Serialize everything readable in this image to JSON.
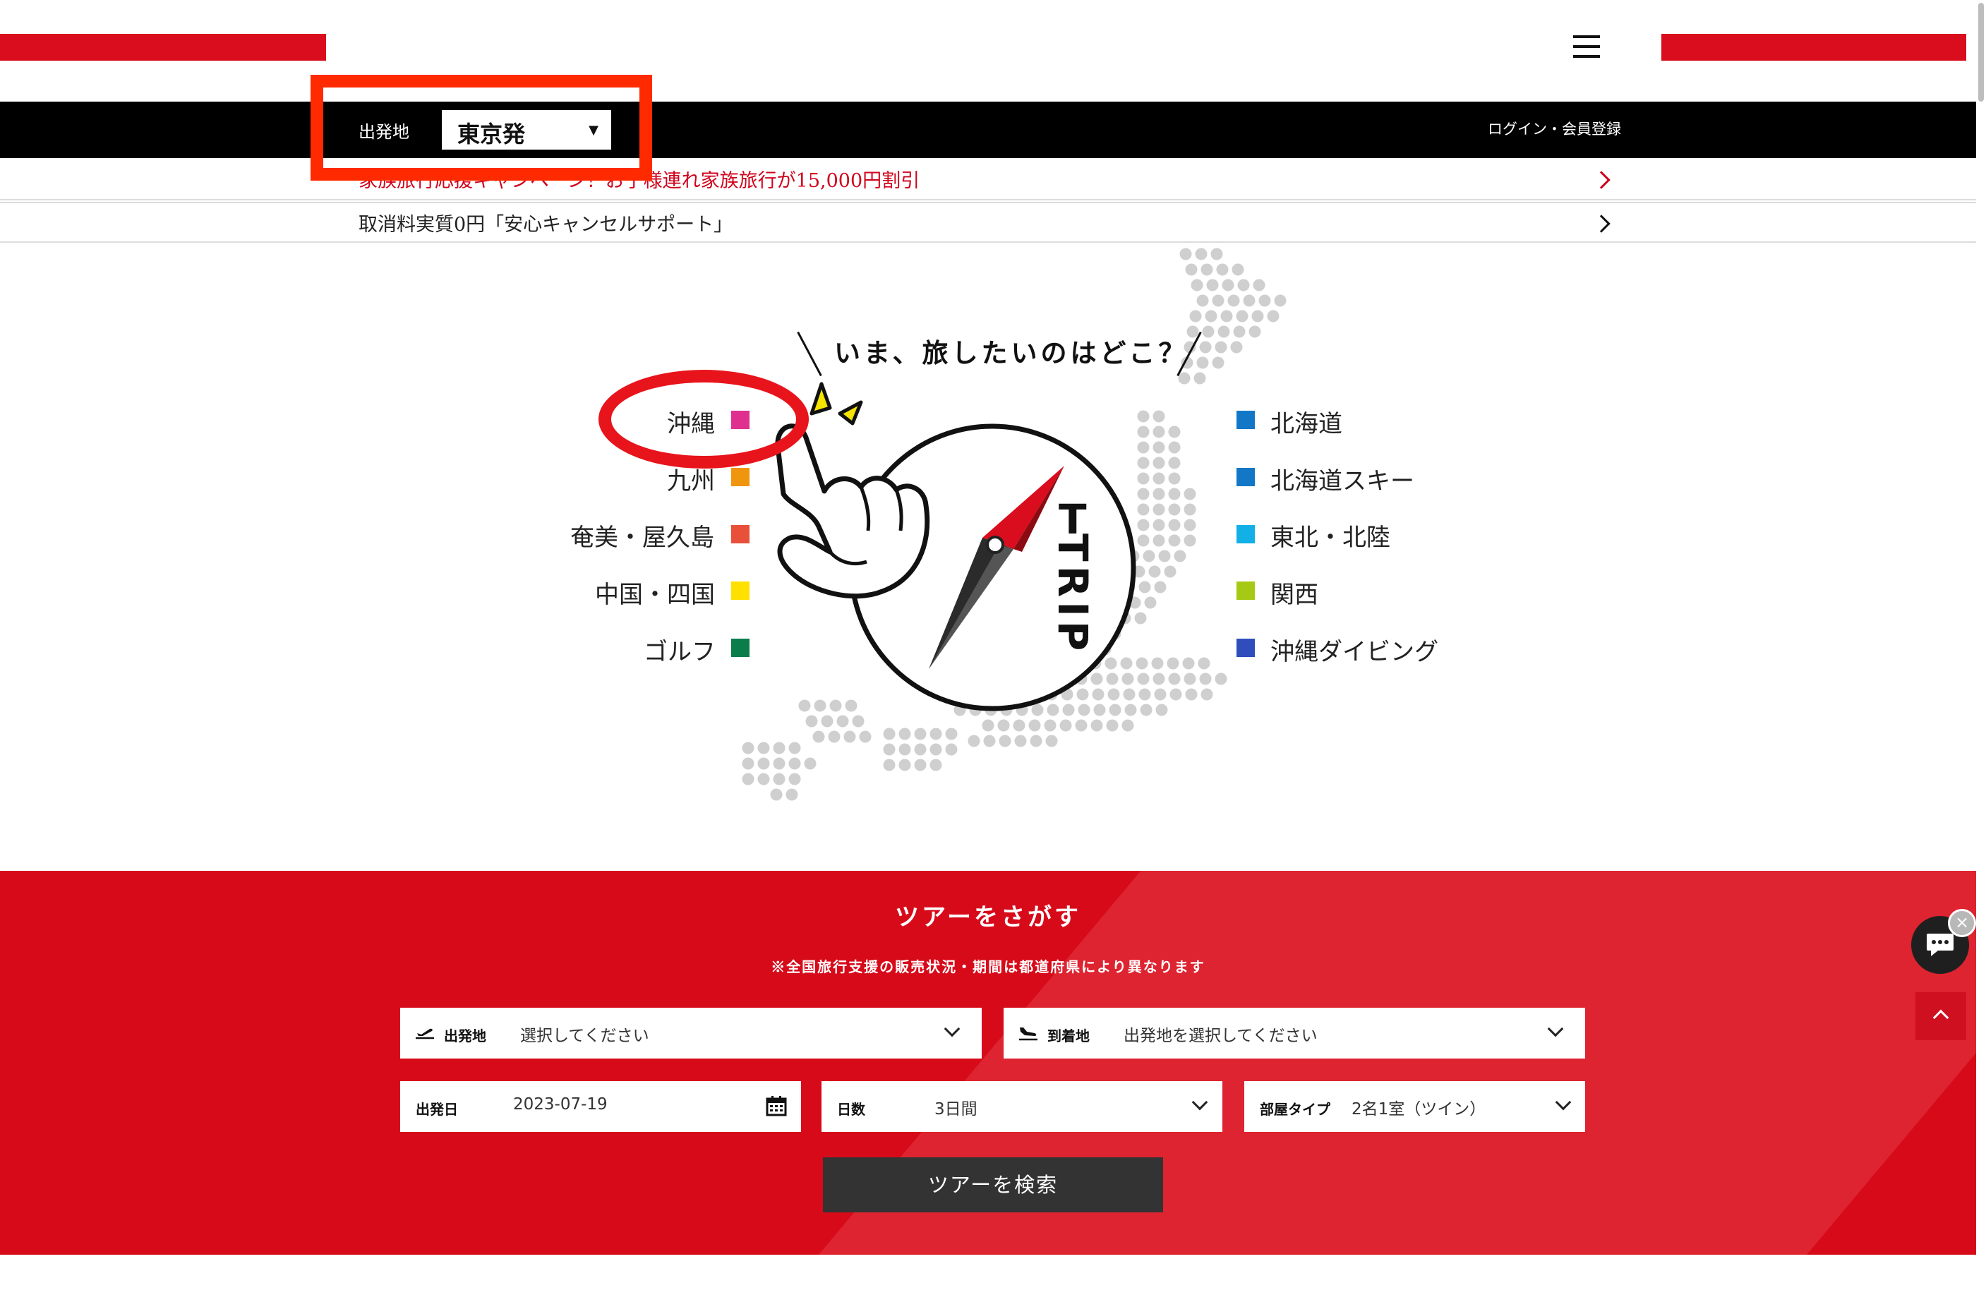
{
  "header": {
    "menu_icon": "hamburger-menu-icon",
    "departure_label": "出発地",
    "departure_value": "東京発",
    "login_link": "ログイン・会員登録"
  },
  "notices": [
    {
      "text": "家族旅行応援キャンペーン！お子様連れ家族旅行が15,000円割引",
      "color": "#d0021b"
    },
    {
      "text": "取消料実質0円「安心キャンセルサポート」",
      "color": "#222222"
    }
  ],
  "hero": {
    "headline": "いま、旅したいのはどこ？",
    "logo_letter": "J",
    "logo_text": "TRIP",
    "destinations_left": [
      {
        "label": "沖縄",
        "color": "#e0308f"
      },
      {
        "label": "九州",
        "color": "#f0950e"
      },
      {
        "label": "奄美・屋久島",
        "color": "#e8503a"
      },
      {
        "label": "中国・四国",
        "color": "#ffe000"
      },
      {
        "label": "ゴルフ",
        "color": "#0a7d4b"
      }
    ],
    "destinations_right": [
      {
        "label": "北海道",
        "color": "#1277c6"
      },
      {
        "label": "北海道スキー",
        "color": "#1277c6"
      },
      {
        "label": "東北・北陸",
        "color": "#12b0e6"
      },
      {
        "label": "関西",
        "color": "#a5c914"
      },
      {
        "label": "沖縄ダイビング",
        "color": "#2f4dbb"
      }
    ]
  },
  "search": {
    "title": "ツアーをさがす",
    "note": "※全国旅行支援の販売状況・期間は都道府県により異なります",
    "departure": {
      "label": "出発地",
      "value": "選択してください"
    },
    "arrival": {
      "label": "到着地",
      "value": "出発地を選択してください"
    },
    "date": {
      "label": "出発日",
      "value": "2023-07-19"
    },
    "days": {
      "label": "日数",
      "value": "3日間"
    },
    "room": {
      "label": "部屋タイプ",
      "value": "2名1室（ツイン）"
    },
    "button": "ツアーを検索"
  },
  "colors": {
    "brand_red": "#d70a1a",
    "annotation_red": "#ff2a00"
  }
}
